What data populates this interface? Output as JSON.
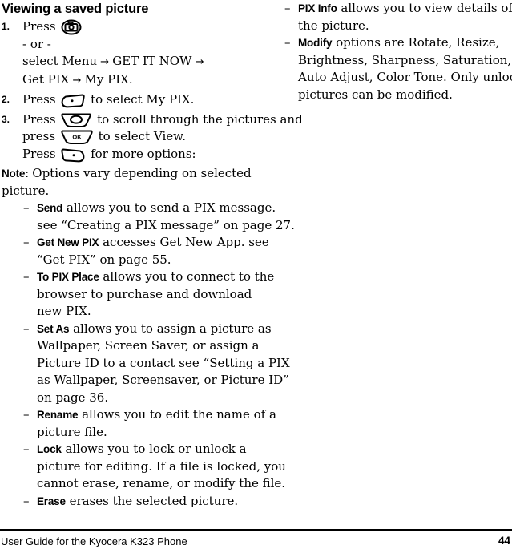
{
  "document": {
    "title": "Viewing a saved picture",
    "footer": {
      "text": "User Guide for the Kyocera K323 Phone",
      "page_number": "44"
    }
  },
  "left_column": {
    "steps": [
      {
        "number": "1.",
        "lines": [
          {
            "type": "text_icon",
            "pre": "Press",
            "icon": "camera-key-icon",
            "post": ""
          },
          {
            "type": "text",
            "text": "- or -"
          },
          {
            "type": "rich",
            "segments": [
              {
                "style": "normal",
                "text": "select "
              },
              {
                "style": "bold",
                "text": "Menu"
              },
              {
                "style": "arrow",
                "text": " → "
              },
              {
                "style": "bold",
                "text": "GET IT NOW"
              },
              {
                "style": "arrow",
                "text": " →"
              }
            ]
          },
          {
            "type": "rich",
            "segments": [
              {
                "style": "bold",
                "text": "Get PIX"
              },
              {
                "style": "arrow",
                "text": " → "
              },
              {
                "style": "bold",
                "text": "My PIX"
              },
              {
                "style": "normal",
                "text": "."
              }
            ]
          }
        ]
      },
      {
        "number": "2.",
        "lines": [
          {
            "type": "rich_icon",
            "pre": "Press",
            "icon": "left-softkey-icon",
            "segments": [
              {
                "style": "normal",
                "text": " to select "
              },
              {
                "style": "bold",
                "text": "My PIX"
              },
              {
                "style": "normal",
                "text": "."
              }
            ]
          }
        ]
      },
      {
        "number": "3.",
        "lines": [
          {
            "type": "rich_icon",
            "pre": "Press",
            "icon": "navigation-key-icon",
            "segments": [
              {
                "style": "normal",
                "text": " to scroll through the pictures and"
              }
            ]
          },
          {
            "type": "rich_icon",
            "pre": "press",
            "icon": "ok-key-icon",
            "segments": [
              {
                "style": "normal",
                "text": " to select "
              },
              {
                "style": "bold",
                "text": "View"
              },
              {
                "style": "normal",
                "text": "."
              }
            ]
          },
          {
            "type": "rich_icon",
            "pre": "Press",
            "icon": "right-softkey-icon",
            "segments": [
              {
                "style": "normal",
                "text": " for more options:"
              }
            ]
          }
        ]
      }
    ],
    "note": {
      "label": "Note:",
      "lines": [
        "Options vary depending on selected",
        "picture."
      ]
    },
    "options": [
      {
        "term": "Send",
        "lines": [
          " allows you to send a PIX message.",
          "see “Creating a PIX message” on page 27."
        ]
      },
      {
        "term": "Get New PIX",
        "lines": [
          " accesses Get New App. see",
          "“Get PIX” on page 55."
        ]
      },
      {
        "term": "To PIX Place",
        "lines": [
          " allows you to connect to the",
          "browser to purchase and download",
          "new PIX."
        ]
      },
      {
        "term": "Set As",
        "lines": [
          " allows you to assign a picture as",
          "Wallpaper, Screen Saver, or assign a",
          "Picture ID to a contact see “Setting a PIX",
          "as Wallpaper, Screensaver, or Picture ID”",
          "on page 36."
        ]
      },
      {
        "term": "Rename",
        "lines": [
          " allows you to edit the name of a",
          "picture file."
        ]
      },
      {
        "term": "Lock",
        "lines": [
          " allows you to lock or unlock a",
          "picture for editing. If a file is locked, you",
          "cannot erase, rename, or modify the file."
        ]
      },
      {
        "term": "Erase",
        "lines": [
          " erases the selected picture."
        ]
      }
    ]
  },
  "right_column": {
    "options": [
      {
        "term": "PIX Info",
        "lines": [
          " allows you to view details of",
          "the picture."
        ]
      },
      {
        "term": "Modify",
        "lines": [
          " options are Rotate, Resize,",
          "Brightness, Sharpness, Saturation, Hue,",
          "Auto Adjust, Color Tone. Only unlocked",
          "pictures can be modified."
        ]
      }
    ]
  },
  "icons": {
    "camera-key-icon": "camera key",
    "left-softkey-icon": "left soft key",
    "navigation-key-icon": "navigation key",
    "ok-key-icon": "OK key",
    "right-softkey-icon": "right soft key"
  }
}
